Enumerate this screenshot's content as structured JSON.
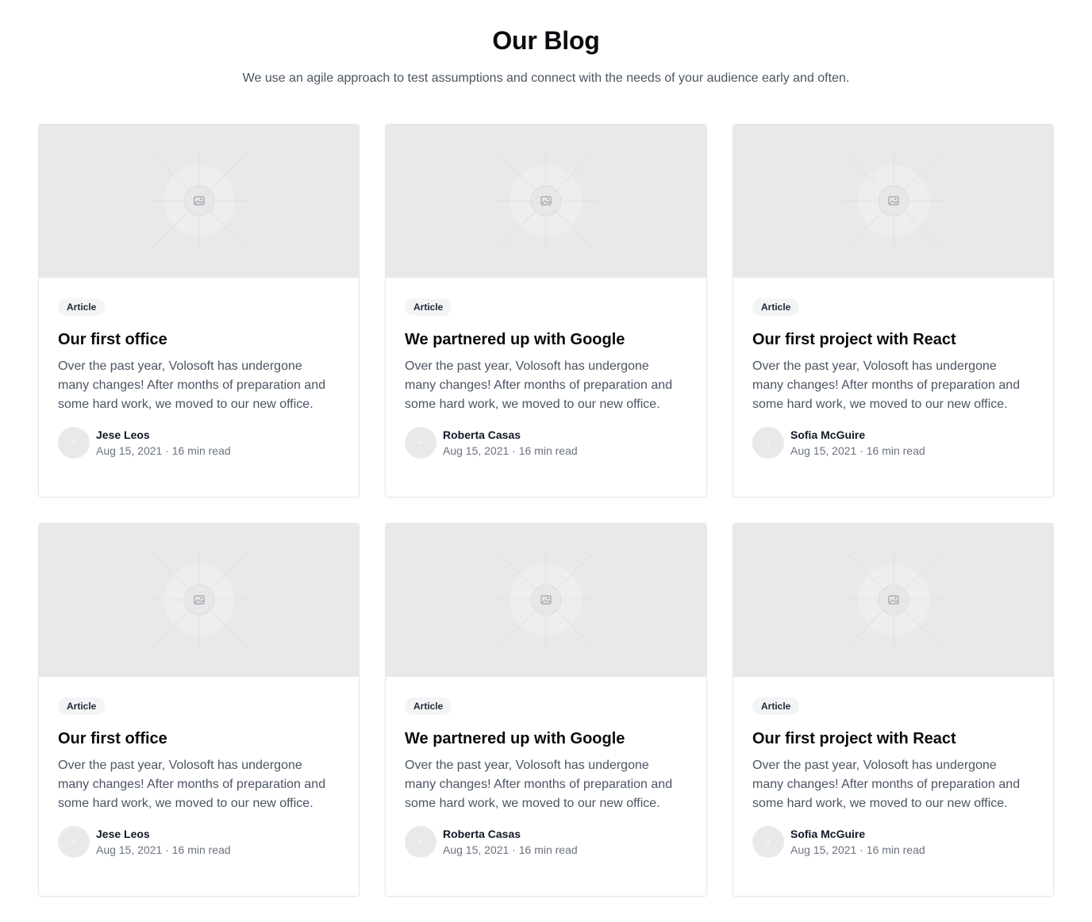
{
  "header": {
    "title": "Our Blog",
    "subtitle": "We use an agile approach to test assumptions and connect with the needs of your audience early and often."
  },
  "posts": [
    {
      "badge": "Article",
      "title": "Our first office",
      "excerpt": "Over the past year, Volosoft has undergone many changes! After months of preparation and some hard work, we moved to our new office.",
      "author": "Jese Leos",
      "meta": "Aug 15, 2021 · 16 min read",
      "image_icon": "image-icon"
    },
    {
      "badge": "Article",
      "title": "We partnered up with Google",
      "excerpt": "Over the past year, Volosoft has undergone many changes! After months of preparation and some hard work, we moved to our new office.",
      "author": "Roberta Casas",
      "meta": "Aug 15, 2021 · 16 min read",
      "image_icon": "image-icon"
    },
    {
      "badge": "Article",
      "title": "Our first project with React",
      "excerpt": "Over the past year, Volosoft has undergone many changes! After months of preparation and some hard work, we moved to our new office.",
      "author": "Sofia McGuire",
      "meta": "Aug 15, 2021 · 16 min read",
      "image_icon": "image-icon"
    },
    {
      "badge": "Article",
      "title": "Our first office",
      "excerpt": "Over the past year, Volosoft has undergone many changes! After months of preparation and some hard work, we moved to our new office.",
      "author": "Jese Leos",
      "meta": "Aug 15, 2021 · 16 min read",
      "image_icon": "image-icon"
    },
    {
      "badge": "Article",
      "title": "We partnered up with Google",
      "excerpt": "Over the past year, Volosoft has undergone many changes! After months of preparation and some hard work, we moved to our new office.",
      "author": "Roberta Casas",
      "meta": "Aug 15, 2021 · 16 min read",
      "image_icon": "image-icon"
    },
    {
      "badge": "Article",
      "title": "Our first project with React",
      "excerpt": "Over the past year, Volosoft has undergone many changes! After months of preparation and some hard work, we moved to our new office.",
      "author": "Sofia McGuire",
      "meta": "Aug 15, 2021 · 16 min read",
      "image_icon": "image-icon"
    }
  ]
}
